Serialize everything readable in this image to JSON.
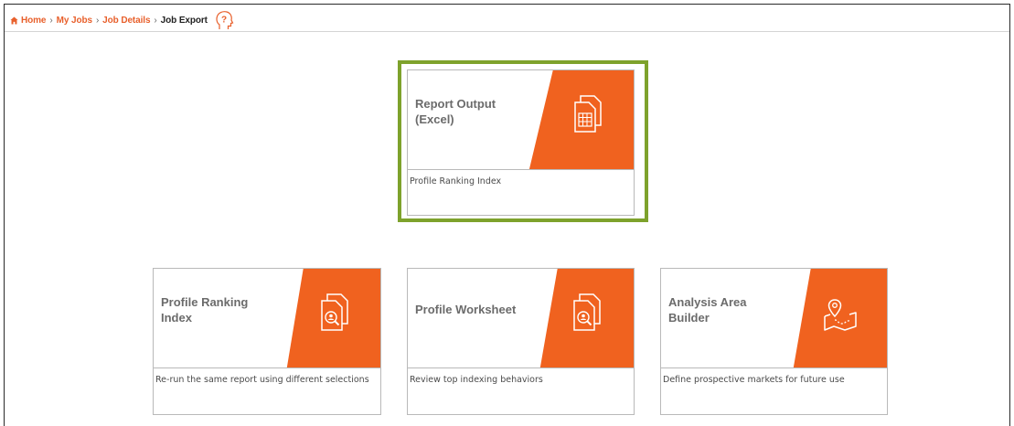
{
  "breadcrumb": {
    "home": "Home",
    "my_jobs": "My Jobs",
    "job_details": "Job Details",
    "current": "Job Export",
    "separator": "›"
  },
  "cards": [
    {
      "title_line1": "Report Output",
      "title_line2": "(Excel)",
      "description": "Profile Ranking Index",
      "icon": "excel-document-icon",
      "selected": true
    },
    {
      "title_line1": "Profile Ranking",
      "title_line2": "Index",
      "description": "Re-run the same report using different selections",
      "icon": "profile-search-document-icon"
    },
    {
      "title_line1": "Profile Worksheet",
      "title_line2": "",
      "description": "Review top indexing behaviors",
      "icon": "profile-search-document-icon"
    },
    {
      "title_line1": "Analysis Area",
      "title_line2": "Builder",
      "description": "Define prospective markets for future use",
      "icon": "map-pin-icon"
    }
  ],
  "colors": {
    "accent": "#f0621f",
    "link": "#e8602c",
    "highlight": "#7ea22c",
    "title_text": "#6b6b6b"
  }
}
